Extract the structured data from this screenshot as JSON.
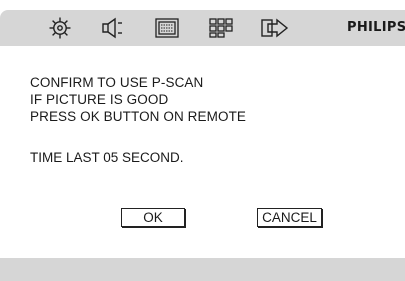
{
  "menu": {
    "icons": [
      "gear-icon",
      "speaker-icon",
      "display-icon",
      "grid-settings-icon",
      "arrow-output-icon"
    ],
    "brand": "PHILIPS"
  },
  "dialog": {
    "lines": [
      "CONFIRM TO USE P-SCAN",
      "IF PICTURE IS GOOD",
      "PRESS OK BUTTON ON REMOTE"
    ],
    "timer": "TIME LAST 05 SECOND.",
    "ok_label": "OK",
    "cancel_label": "CANCEL"
  },
  "colors": {
    "bar": "#d6d6d6",
    "background": "#ffffff",
    "text": "#1a1a1a"
  }
}
